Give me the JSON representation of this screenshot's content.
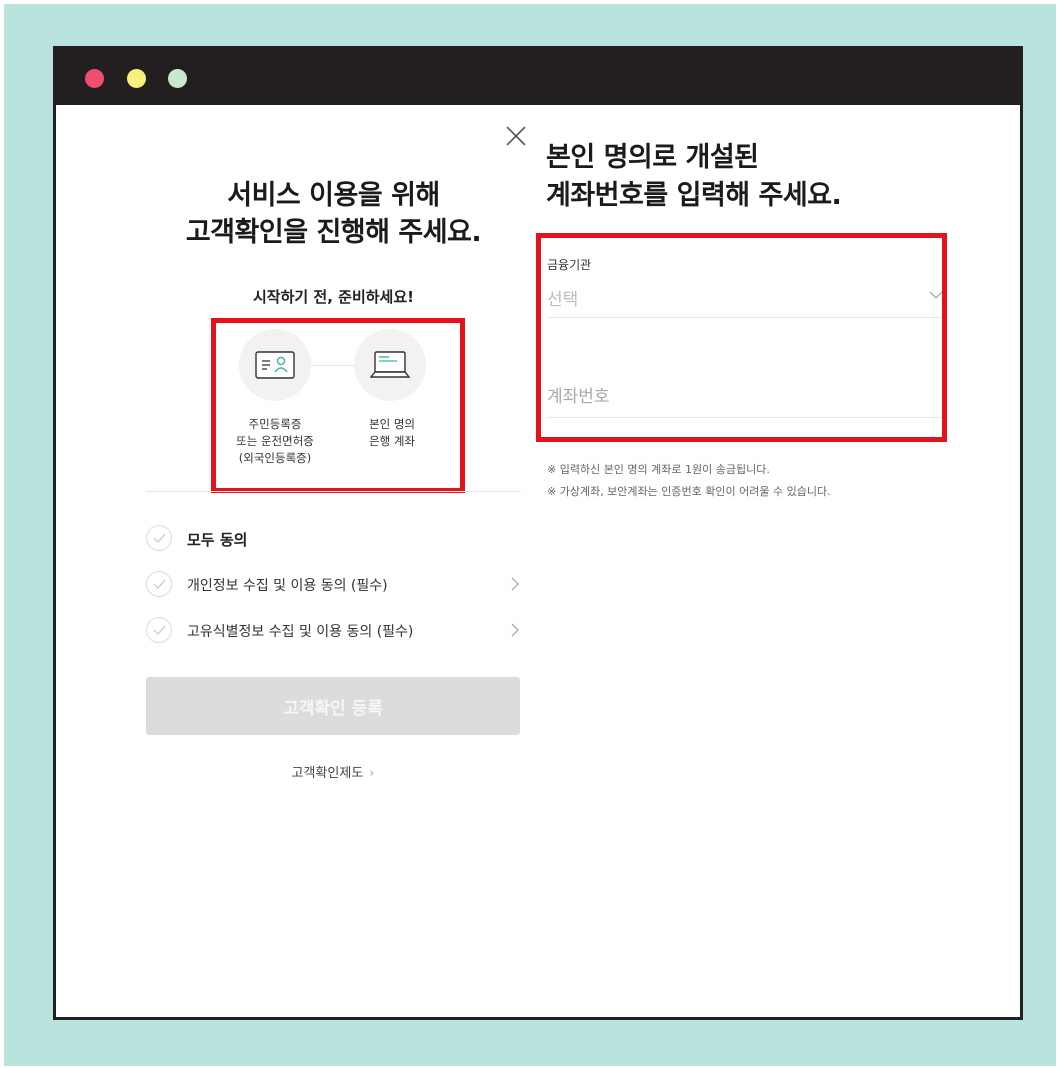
{
  "left": {
    "title_line1": "서비스 이용을 위해",
    "title_line2": "고객확인을 진행해 주세요.",
    "prep_text": "시작하기 전, 준비하세요!",
    "items": [
      {
        "icon": "id-card-icon",
        "caption": [
          "주민등록증",
          "또는 운전면허증",
          "(외국인등록증)"
        ]
      },
      {
        "icon": "laptop-icon",
        "caption": [
          "본인 명의",
          "은행 계좌"
        ]
      }
    ],
    "agreements": [
      {
        "label": "모두 동의"
      },
      {
        "label": "개인정보 수집 및 이용 동의 (필수)"
      },
      {
        "label": "고유식별정보 수집 및 이용 동의 (필수)"
      }
    ],
    "submit_label": "고객확인 등록",
    "policy_link": "고객확인제도"
  },
  "right": {
    "title_line1": "본인 명의로 개설된",
    "title_line2": "계좌번호를 입력해 주세요.",
    "bank_label": "금융기관",
    "bank_value": "선택",
    "account_placeholder": "계좌번호",
    "notes": [
      "※ 입력하신 본인 명의 계좌로 1원이 송금됩니다.",
      "※ 가상계좌, 보안계좌는 인증번호 확인이 어려울 수 있습니다."
    ]
  },
  "colors": {
    "background": "#b9e4de",
    "titlebar": "#231f20",
    "highlight": "#e4121b",
    "dots": [
      "#ef4e6c",
      "#f7f07a",
      "#c9e8cf"
    ]
  }
}
